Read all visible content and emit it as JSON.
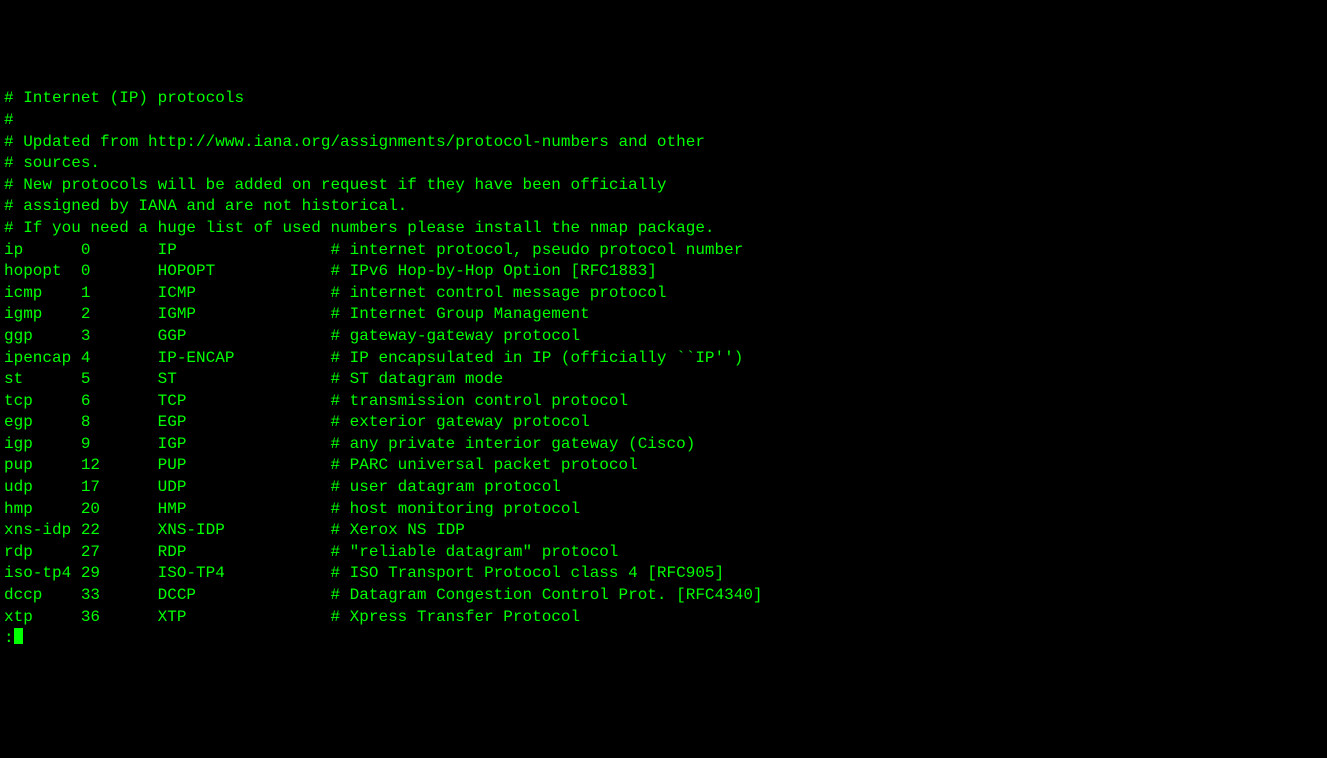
{
  "header_comments": [
    "# Internet (IP) protocols",
    "#",
    "# Updated from http://www.iana.org/assignments/protocol-numbers and other",
    "# sources.",
    "# New protocols will be added on request if they have been officially",
    "# assigned by IANA and are not historical.",
    "# If you need a huge list of used numbers please install the nmap package.",
    ""
  ],
  "protocols": [
    {
      "name": "ip",
      "num": "0",
      "alias": "IP",
      "comment": "# internet protocol, pseudo protocol number"
    },
    {
      "name": "hopopt",
      "num": "0",
      "alias": "HOPOPT",
      "comment": "# IPv6 Hop-by-Hop Option [RFC1883]"
    },
    {
      "name": "icmp",
      "num": "1",
      "alias": "ICMP",
      "comment": "# internet control message protocol"
    },
    {
      "name": "igmp",
      "num": "2",
      "alias": "IGMP",
      "comment": "# Internet Group Management"
    },
    {
      "name": "ggp",
      "num": "3",
      "alias": "GGP",
      "comment": "# gateway-gateway protocol"
    },
    {
      "name": "ipencap",
      "num": "4",
      "alias": "IP-ENCAP",
      "comment": "# IP encapsulated in IP (officially ``IP'')"
    },
    {
      "name": "st",
      "num": "5",
      "alias": "ST",
      "comment": "# ST datagram mode"
    },
    {
      "name": "tcp",
      "num": "6",
      "alias": "TCP",
      "comment": "# transmission control protocol"
    },
    {
      "name": "egp",
      "num": "8",
      "alias": "EGP",
      "comment": "# exterior gateway protocol"
    },
    {
      "name": "igp",
      "num": "9",
      "alias": "IGP",
      "comment": "# any private interior gateway (Cisco)"
    },
    {
      "name": "pup",
      "num": "12",
      "alias": "PUP",
      "comment": "# PARC universal packet protocol"
    },
    {
      "name": "udp",
      "num": "17",
      "alias": "UDP",
      "comment": "# user datagram protocol"
    },
    {
      "name": "hmp",
      "num": "20",
      "alias": "HMP",
      "comment": "# host monitoring protocol"
    },
    {
      "name": "xns-idp",
      "num": "22",
      "alias": "XNS-IDP",
      "comment": "# Xerox NS IDP"
    },
    {
      "name": "rdp",
      "num": "27",
      "alias": "RDP",
      "comment": "# \"reliable datagram\" protocol"
    },
    {
      "name": "iso-tp4",
      "num": "29",
      "alias": "ISO-TP4",
      "comment": "# ISO Transport Protocol class 4 [RFC905]"
    },
    {
      "name": "dccp",
      "num": "33",
      "alias": "DCCP",
      "comment": "# Datagram Congestion Control Prot. [RFC4340]"
    },
    {
      "name": "xtp",
      "num": "36",
      "alias": "XTP",
      "comment": "# Xpress Transfer Protocol"
    }
  ],
  "prompt_prefix": ":"
}
